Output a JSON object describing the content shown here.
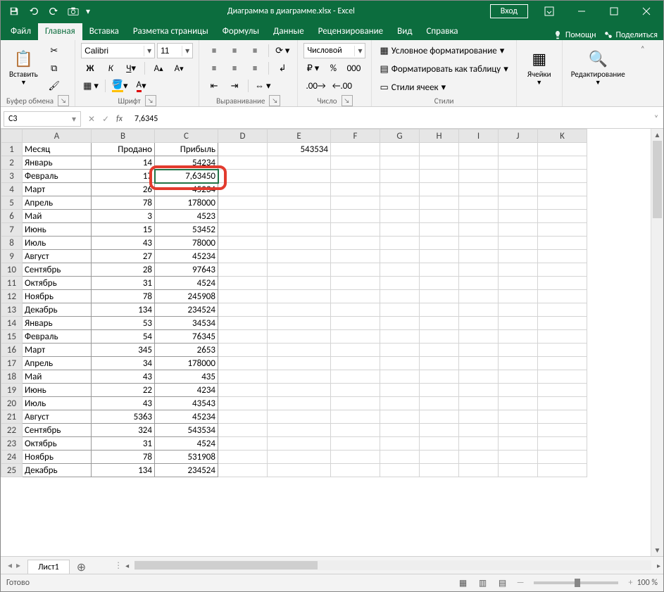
{
  "title": "Диаграмма в диаграмме.xlsx  -  Excel",
  "login_label": "Вход",
  "tabs": [
    "Файл",
    "Главная",
    "Вставка",
    "Разметка страницы",
    "Формулы",
    "Данные",
    "Рецензирование",
    "Вид",
    "Справка"
  ],
  "active_tab": 1,
  "help_hint": "Помощн",
  "share_label": "Поделиться",
  "ribbon": {
    "clipboard": {
      "label": "Буфер обмена",
      "paste": "Вставить"
    },
    "font": {
      "label": "Шрифт",
      "name": "Calibri",
      "size": "11"
    },
    "align": {
      "label": "Выравнивание"
    },
    "number": {
      "label": "Число",
      "format": "Числовой"
    },
    "styles": {
      "label": "Стили",
      "cond": "Условное форматирование",
      "table": "Форматировать как таблицу",
      "cell": "Стили ячеек"
    },
    "cells": {
      "label": "Ячейки"
    },
    "editing": {
      "label": "Редактирование"
    }
  },
  "namebox": "C3",
  "formula": "7,6345",
  "columns": [
    "A",
    "B",
    "C",
    "D",
    "E",
    "F",
    "G",
    "H",
    "I",
    "J",
    "K"
  ],
  "rows": [
    {
      "n": 1,
      "A": "Месяц",
      "B": "Продано",
      "C": "Прибыль",
      "E": "543534"
    },
    {
      "n": 2,
      "A": "Январь",
      "B": "14",
      "C": "54234"
    },
    {
      "n": 3,
      "A": "Февраль",
      "B": "17",
      "C": "7,63450"
    },
    {
      "n": 4,
      "A": "Март",
      "B": "26",
      "C": "45234"
    },
    {
      "n": 5,
      "A": "Апрель",
      "B": "78",
      "C": "178000"
    },
    {
      "n": 6,
      "A": "Май",
      "B": "3",
      "C": "4523"
    },
    {
      "n": 7,
      "A": "Июнь",
      "B": "15",
      "C": "53452"
    },
    {
      "n": 8,
      "A": "Июль",
      "B": "43",
      "C": "78000"
    },
    {
      "n": 9,
      "A": "Август",
      "B": "27",
      "C": "45234"
    },
    {
      "n": 10,
      "A": "Сентябрь",
      "B": "28",
      "C": "97643"
    },
    {
      "n": 11,
      "A": "Октябрь",
      "B": "31",
      "C": "4524"
    },
    {
      "n": 12,
      "A": "Ноябрь",
      "B": "78",
      "C": "245908"
    },
    {
      "n": 13,
      "A": "Декабрь",
      "B": "134",
      "C": "234524"
    },
    {
      "n": 14,
      "A": "Январь",
      "B": "53",
      "C": "34534"
    },
    {
      "n": 15,
      "A": "Февраль",
      "B": "54",
      "C": "76345"
    },
    {
      "n": 16,
      "A": "Март",
      "B": "345",
      "C": "2653"
    },
    {
      "n": 17,
      "A": "Апрель",
      "B": "34",
      "C": "178000"
    },
    {
      "n": 18,
      "A": "Май",
      "B": "43",
      "C": "435"
    },
    {
      "n": 19,
      "A": "Июнь",
      "B": "22",
      "C": "4234"
    },
    {
      "n": 20,
      "A": "Июль",
      "B": "43",
      "C": "43543"
    },
    {
      "n": 21,
      "A": "Август",
      "B": "5363",
      "C": "45234"
    },
    {
      "n": 22,
      "A": "Сентябрь",
      "B": "324",
      "C": "543534"
    },
    {
      "n": 23,
      "A": "Октябрь",
      "B": "31",
      "C": "4524"
    },
    {
      "n": 24,
      "A": "Ноябрь",
      "B": "78",
      "C": "531908"
    },
    {
      "n": 25,
      "A": "Декабрь",
      "B": "134",
      "C": "234524"
    }
  ],
  "selected_cell": "C3",
  "sheet_name": "Лист1",
  "status_text": "Готово",
  "zoom": "100 %"
}
